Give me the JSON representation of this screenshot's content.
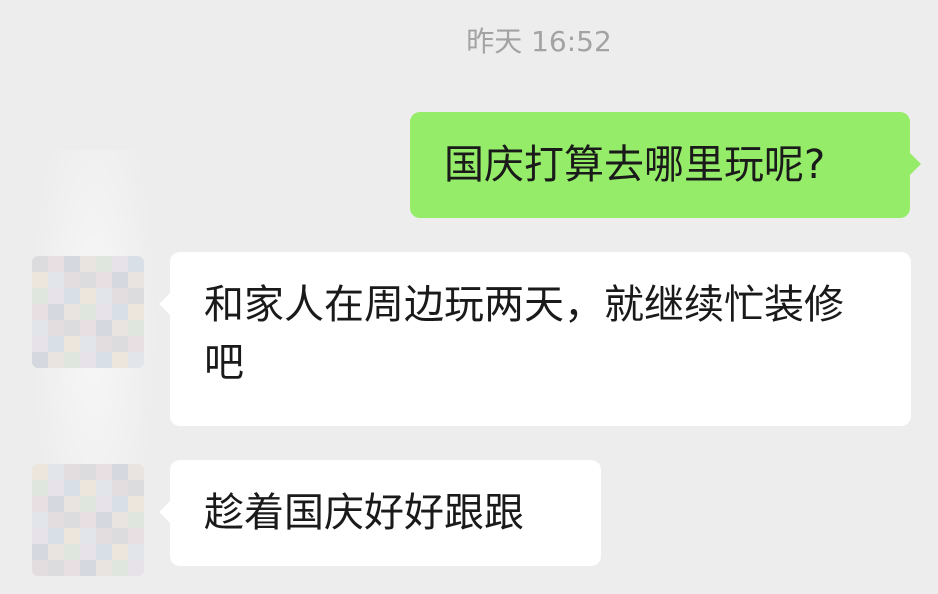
{
  "chat": {
    "timestamp": "昨天 16:52",
    "messages": [
      {
        "direction": "outgoing",
        "text": "国庆打算去哪里玩呢?"
      },
      {
        "direction": "incoming",
        "text": "和家人在周边玩两天，就继续忙装修吧"
      },
      {
        "direction": "incoming",
        "text": "趁着国庆好好跟跟"
      }
    ]
  },
  "colors": {
    "background": "#ededed",
    "outgoing_bubble": "#95ec69",
    "incoming_bubble": "#ffffff",
    "timestamp_text": "#a3a3a3"
  },
  "avatars": {
    "style": "pixelated-mosaic",
    "palette": [
      "#dcdcde",
      "#e4dde0",
      "#e2e5ea",
      "#ece6dc",
      "#d9dfe6",
      "#e7e1e9",
      "#dfe6de",
      "#e9e4e0",
      "#d6d8df",
      "#e8dfe3"
    ]
  }
}
